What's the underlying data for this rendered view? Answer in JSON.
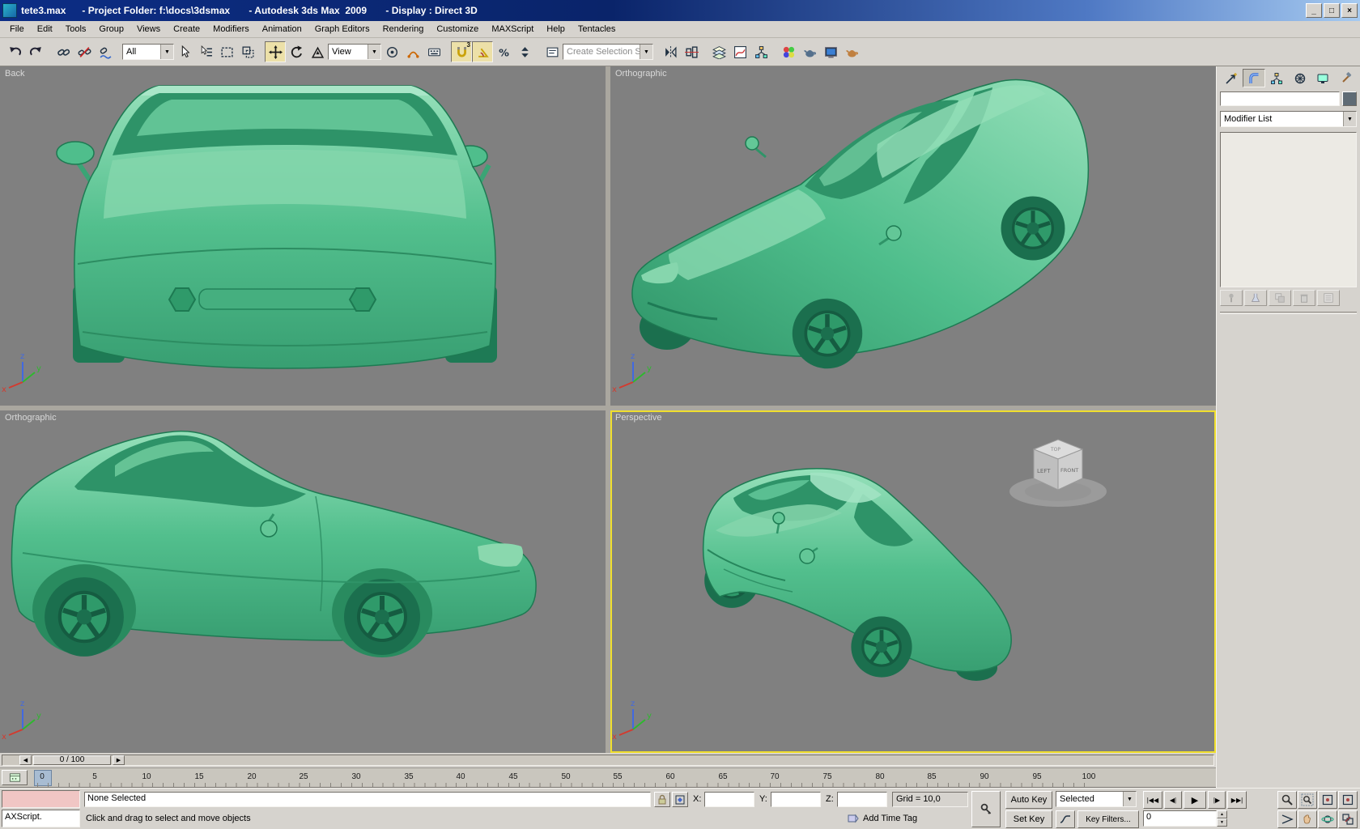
{
  "titlebar": {
    "title": "tete3.max      - Project Folder: f:\\docs\\3dsmax       - Autodesk 3ds Max  2009       - Display : Direct 3D"
  },
  "menu": {
    "items": [
      "File",
      "Edit",
      "Tools",
      "Group",
      "Views",
      "Create",
      "Modifiers",
      "Animation",
      "Graph Editors",
      "Rendering",
      "Customize",
      "MAXScript",
      "Help",
      "Tentacles"
    ]
  },
  "toolbar": {
    "selection_filter": "All",
    "coordinate_system": "View",
    "named_selection_placeholder": "Create Selection Set",
    "snap_level": "3"
  },
  "viewports": {
    "back": "Back",
    "ortho_top": "Orthographic",
    "ortho_bottom": "Orthographic",
    "perspective": "Perspective"
  },
  "viewcube": {
    "left": "LEFT",
    "front": "FRONT",
    "top": "TOP"
  },
  "axis": {
    "x": "x",
    "y": "y",
    "z": "z"
  },
  "command_panel": {
    "modifier_list": "Modifier List"
  },
  "timeline": {
    "slider_value": "0 / 100",
    "ticks": [
      "0",
      "5",
      "10",
      "15",
      "20",
      "25",
      "30",
      "35",
      "40",
      "45",
      "50",
      "55",
      "60",
      "65",
      "70",
      "75",
      "80",
      "85",
      "90",
      "95",
      "100"
    ]
  },
  "status": {
    "maxscript": "AXScript.",
    "selection": "None Selected",
    "prompt": "Click and drag to select and move objects",
    "x_label": "X:",
    "y_label": "Y:",
    "z_label": "Z:",
    "x_value": "",
    "y_value": "",
    "z_value": "",
    "grid": "Grid = 10,0",
    "add_time_tag": "Add Time Tag",
    "auto_key": "Auto Key",
    "set_key": "Set Key",
    "key_mode": "Selected",
    "key_filters": "Key Filters...",
    "frame": "0"
  },
  "icons": {
    "minimize": "_",
    "maximize": "□",
    "close": "×",
    "dropdown": "▼",
    "slider_left": "◀",
    "slider_right": "▶",
    "go_start": "|◀◀",
    "prev_frame": "◀|",
    "play": "▶",
    "next_frame": "|▶",
    "go_end": "▶▶|",
    "spin_up": "▲",
    "spin_down": "▼"
  },
  "colors": {
    "car_green": "#4fbe8c",
    "car_green_dark": "#2e9368",
    "viewport_bg": "#808080",
    "active_viewport_border": "#f0df2e",
    "chrome": "#d6d3ce",
    "titlebar_gradient_start": "#0a246a",
    "titlebar_gradient_end": "#a6caf0",
    "maxscript_pink": "#f0c6c4"
  }
}
